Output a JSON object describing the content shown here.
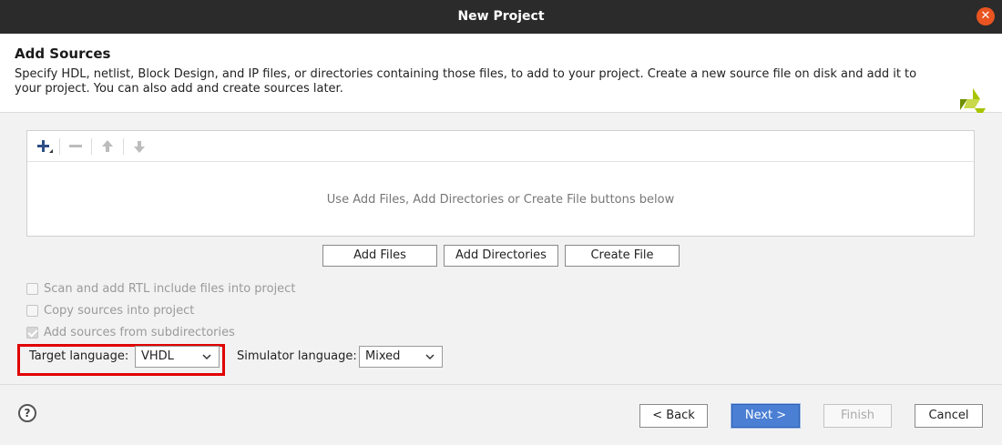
{
  "window": {
    "title": "New Project"
  },
  "header": {
    "title": "Add Sources",
    "description": "Specify HDL, netlist, Block Design, and IP files, or directories containing those files, to add to your project. Create a new source file on disk and add it to your project. You can also add and create sources later."
  },
  "files_panel": {
    "toolbar": {
      "add": "add-icon",
      "remove": "remove-icon",
      "up": "arrow-up-icon",
      "down": "arrow-down-icon"
    },
    "empty_message": "Use Add Files, Add Directories or Create File buttons below"
  },
  "actions": {
    "add_files": "Add Files",
    "add_directories": "Add Directories",
    "create_file": "Create File"
  },
  "options": {
    "scan_rtl": {
      "label": "Scan and add RTL include files into project",
      "checked": false,
      "enabled": false
    },
    "copy_sources": {
      "label": "Copy sources into project",
      "checked": false,
      "enabled": false
    },
    "add_subdirs": {
      "label": "Add sources from subdirectories",
      "checked": true,
      "enabled": false
    }
  },
  "language": {
    "target_label": "Target language:",
    "target_value": "VHDL",
    "simulator_label": "Simulator language:",
    "simulator_value": "Mixed"
  },
  "footer": {
    "help": "?",
    "back": "< Back",
    "next": "Next >",
    "finish": "Finish",
    "cancel": "Cancel"
  },
  "colors": {
    "titlebar": "#2b2b2b",
    "close": "#e95420",
    "primary_button": "#4a7fd4",
    "highlight": "#e00000",
    "logo": "#a8c400"
  }
}
